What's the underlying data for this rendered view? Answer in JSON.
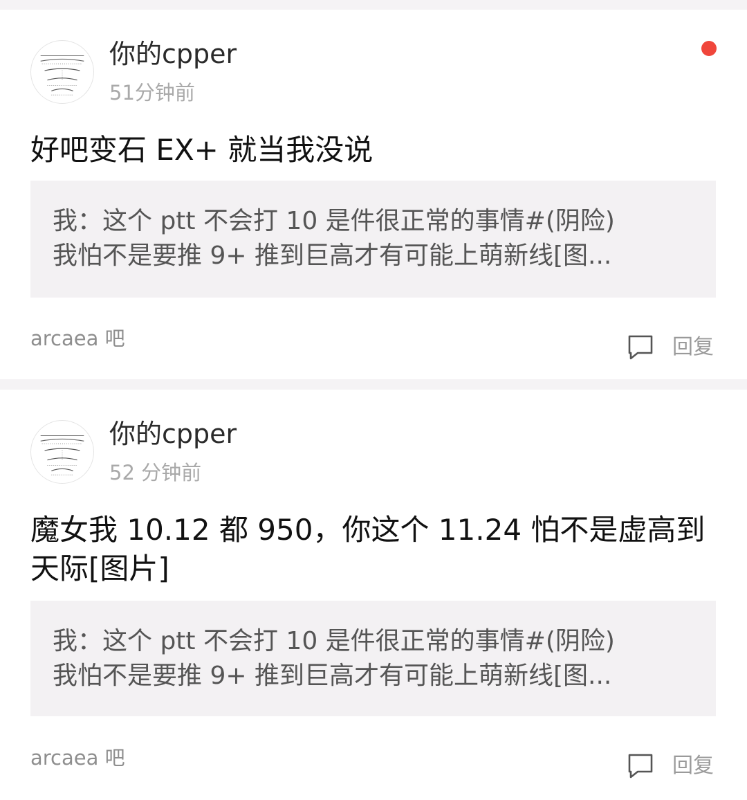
{
  "posts": [
    {
      "username": "你的cpper",
      "time": "51分钟前",
      "unread": true,
      "title": "好吧变石 EX+ 就当我没说",
      "quote": {
        "line1": "我：这个 ptt 不会打 10 是件很正常的事情#(阴险)",
        "line2": "我怕不是要推 9+ 推到巨高才有可能上萌新线[图..."
      },
      "forum": "arcaea 吧",
      "reply_label": "回复"
    },
    {
      "username": "你的cpper",
      "time": "52 分钟前",
      "unread": false,
      "title": "魔女我 10.12 都 950，你这个 11.24 怕不是虚高到天际[图片]",
      "quote": {
        "line1": "我：这个 ptt 不会打 10 是件很正常的事情#(阴险)",
        "line2": "我怕不是要推 9+ 推到巨高才有可能上萌新线[图..."
      },
      "forum": "arcaea 吧",
      "reply_label": "回复"
    }
  ],
  "colors": {
    "unread_dot": "#f0463b",
    "page_background": "#f5f3f5",
    "quote_background": "#f3f1f3"
  },
  "icons": {
    "avatar": "avatar-image",
    "reply": "comment-bubble-icon"
  }
}
